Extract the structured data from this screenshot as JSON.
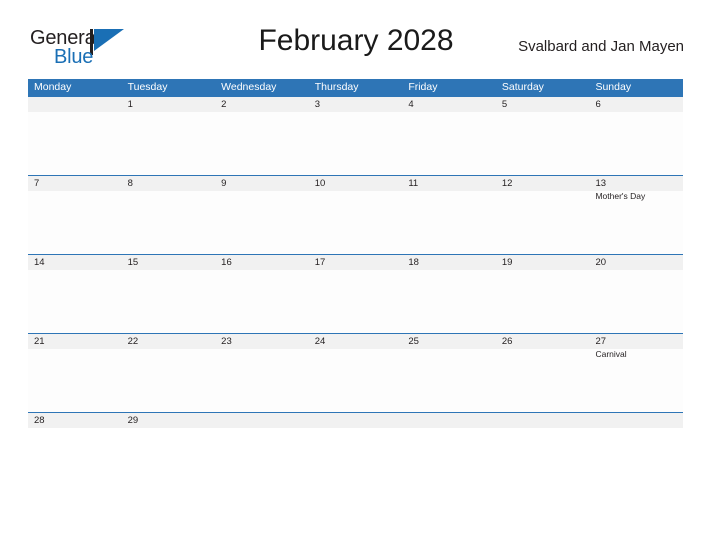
{
  "brand": {
    "name_top": "General",
    "name_bottom": "Blue",
    "flag_icon": "flag-triangle-icon",
    "color_top": "#231f20",
    "color_bottom": "#1a6fb5"
  },
  "header": {
    "title": "February 2028",
    "subtitle": "Svalbard and Jan Mayen"
  },
  "colors": {
    "header_blue": "#2e75b6",
    "band_gray": "#f1f1f1",
    "cell_white": "#fdfdfd",
    "text": "#231f20"
  },
  "calendar": {
    "weekdays": [
      "Monday",
      "Tuesday",
      "Wednesday",
      "Thursday",
      "Friday",
      "Saturday",
      "Sunday"
    ],
    "weeks": [
      {
        "days": [
          {
            "num": "",
            "event": ""
          },
          {
            "num": "1",
            "event": ""
          },
          {
            "num": "2",
            "event": ""
          },
          {
            "num": "3",
            "event": ""
          },
          {
            "num": "4",
            "event": ""
          },
          {
            "num": "5",
            "event": ""
          },
          {
            "num": "6",
            "event": ""
          }
        ]
      },
      {
        "days": [
          {
            "num": "7",
            "event": ""
          },
          {
            "num": "8",
            "event": ""
          },
          {
            "num": "9",
            "event": ""
          },
          {
            "num": "10",
            "event": ""
          },
          {
            "num": "11",
            "event": ""
          },
          {
            "num": "12",
            "event": ""
          },
          {
            "num": "13",
            "event": "Mother's Day"
          }
        ]
      },
      {
        "days": [
          {
            "num": "14",
            "event": ""
          },
          {
            "num": "15",
            "event": ""
          },
          {
            "num": "16",
            "event": ""
          },
          {
            "num": "17",
            "event": ""
          },
          {
            "num": "18",
            "event": ""
          },
          {
            "num": "19",
            "event": ""
          },
          {
            "num": "20",
            "event": ""
          }
        ]
      },
      {
        "days": [
          {
            "num": "21",
            "event": ""
          },
          {
            "num": "22",
            "event": ""
          },
          {
            "num": "23",
            "event": ""
          },
          {
            "num": "24",
            "event": ""
          },
          {
            "num": "25",
            "event": ""
          },
          {
            "num": "26",
            "event": ""
          },
          {
            "num": "27",
            "event": "Carnival"
          }
        ]
      },
      {
        "days": [
          {
            "num": "28",
            "event": ""
          },
          {
            "num": "29",
            "event": ""
          },
          {
            "num": "",
            "event": ""
          },
          {
            "num": "",
            "event": ""
          },
          {
            "num": "",
            "event": ""
          },
          {
            "num": "",
            "event": ""
          },
          {
            "num": "",
            "event": ""
          }
        ]
      }
    ]
  }
}
